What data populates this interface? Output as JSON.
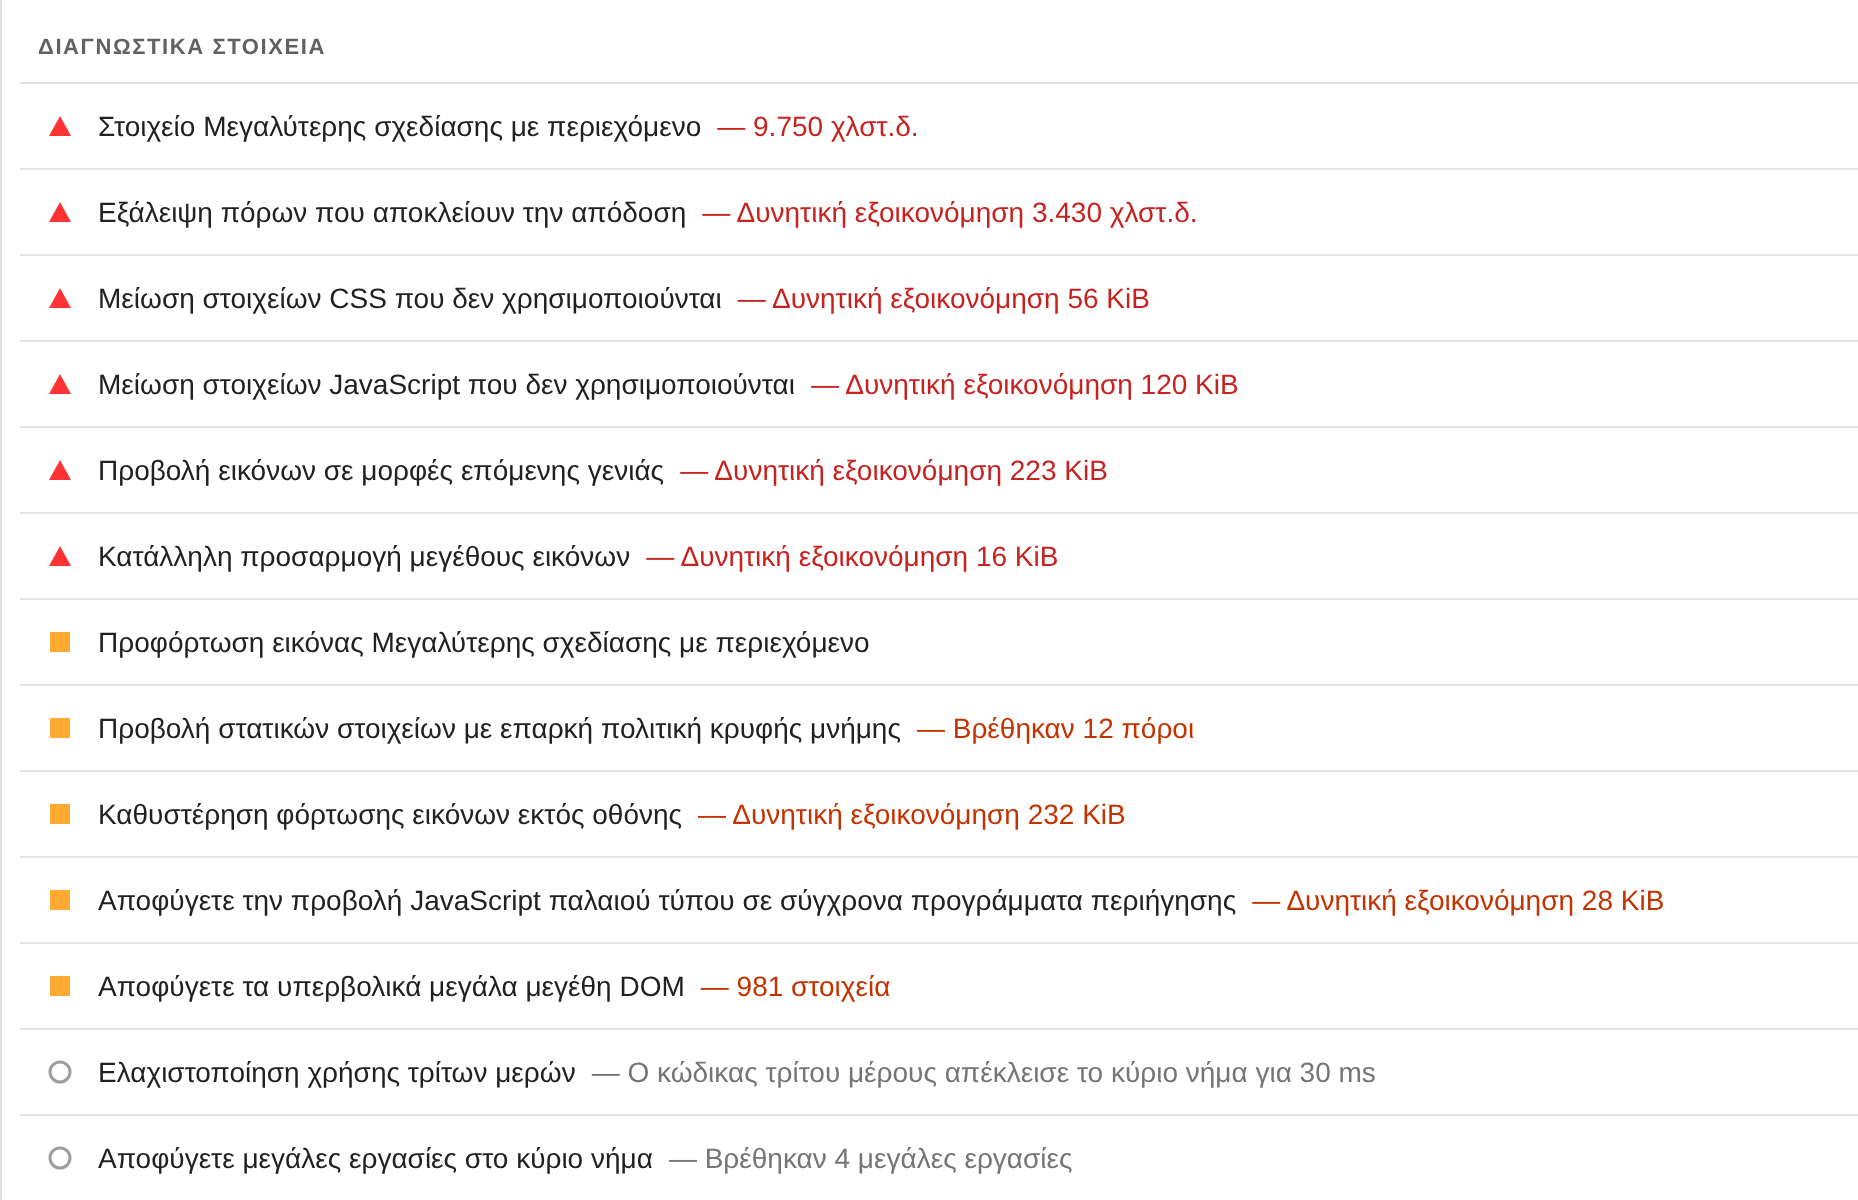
{
  "section": {
    "title": "ΔΙΑΓΝΩΣΤΙΚΑ ΣΤΟΙΧΕΙΑ"
  },
  "audits": [
    {
      "kind": "fail",
      "title": "Στοιχείο Μεγαλύτερης σχεδίασης με περιεχόμενο",
      "display": "— 9.750 χλστ.δ."
    },
    {
      "kind": "fail",
      "title": "Εξάλειψη πόρων που αποκλείουν την απόδοση",
      "display": "— Δυνητική εξοικονόμηση 3.430 χλστ.δ."
    },
    {
      "kind": "fail",
      "title": "Μείωση στοιχείων CSS που δεν χρησιμοποιούνται",
      "display": "— Δυνητική εξοικονόμηση 56 KiB"
    },
    {
      "kind": "fail",
      "title": "Μείωση στοιχείων JavaScript που δεν χρησιμοποιούνται",
      "display": "— Δυνητική εξοικονόμηση 120 KiB"
    },
    {
      "kind": "fail",
      "title": "Προβολή εικόνων σε μορφές επόμενης γενιάς",
      "display": "— Δυνητική εξοικονόμηση 223 KiB"
    },
    {
      "kind": "fail",
      "title": "Κατάλληλη προσαρμογή μεγέθους εικόνων",
      "display": "— Δυνητική εξοικονόμηση 16 KiB"
    },
    {
      "kind": "average",
      "title": "Προφόρτωση εικόνας Μεγαλύτερης σχεδίασης με περιεχόμενο"
    },
    {
      "kind": "average",
      "title": "Προβολή στατικών στοιχείων με επαρκή πολιτική κρυφής μνήμης",
      "display": "— Βρέθηκαν 12 πόροι"
    },
    {
      "kind": "average",
      "title": "Καθυστέρηση φόρτωσης εικόνων εκτός οθόνης",
      "display": "— Δυνητική εξοικονόμηση 232 KiB"
    },
    {
      "kind": "average",
      "title": "Αποφύγετε την προβολή JavaScript παλαιού τύπου σε σύγχρονα προγράμματα περιήγησης",
      "display": "— Δυνητική εξοικονόμηση 28 KiB"
    },
    {
      "kind": "average",
      "title": "Αποφύγετε τα υπερβολικά μεγάλα μεγέθη DOM",
      "display": "— 981 στοιχεία"
    },
    {
      "kind": "informative",
      "title": "Ελαχιστοποίηση χρήσης τρίτων μερών",
      "display": "— Ο κώδικας τρίτου μέρους απέκλεισε το κύριο νήμα για 30 ms"
    },
    {
      "kind": "informative",
      "title": "Αποφύγετε μεγάλες εργασίες στο κύριο νήμα",
      "display": "— Βρέθηκαν 4 μεγάλες εργασίες"
    }
  ]
}
